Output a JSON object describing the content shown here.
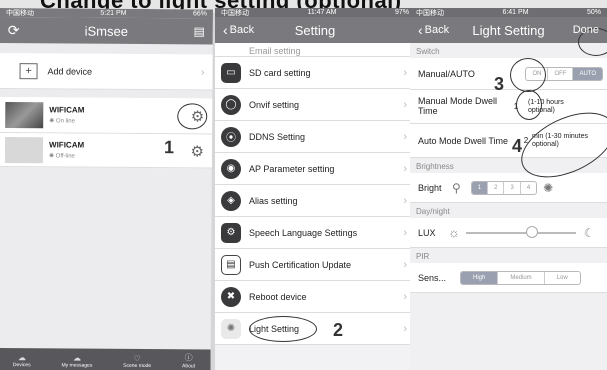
{
  "top_caption": "Change to light setting (optional)",
  "panel1": {
    "status": {
      "carrier": "中国移动",
      "time": "5:21 PM",
      "battery": "66%"
    },
    "title": "iSmsee",
    "add_device": "Add device",
    "cameras": [
      {
        "name": "WIFICAM",
        "status": "On line"
      },
      {
        "name": "WIFICAM",
        "status": "Off-line"
      }
    ],
    "step_number": "1",
    "tabs": [
      "Devices",
      "My messages",
      "Scene mode",
      "About"
    ]
  },
  "panel2": {
    "status": {
      "carrier": "中国移动",
      "time": "11:47 AM",
      "battery": "97%"
    },
    "back": "Back",
    "title": "Setting",
    "partial_item": "Email setting",
    "items": [
      {
        "label": "SD card setting",
        "icon": "sd-card-icon"
      },
      {
        "label": "Onvif setting",
        "icon": "onvif-icon"
      },
      {
        "label": "DDNS Setting",
        "icon": "ddns-icon"
      },
      {
        "label": "AP Parameter setting",
        "icon": "ap-icon"
      },
      {
        "label": "Alias setting",
        "icon": "alias-icon"
      },
      {
        "label": "Speech Language Settings",
        "icon": "speech-gear-icon"
      },
      {
        "label": "Push Certification Update",
        "icon": "push-cert-icon"
      },
      {
        "label": "Reboot device",
        "icon": "reboot-icon"
      },
      {
        "label": "Light Setting",
        "icon": "light-bulb-icon"
      }
    ],
    "step_number": "2"
  },
  "panel3": {
    "status": {
      "carrier": "中国移动",
      "time": "6:41 PM",
      "battery": "50%"
    },
    "back": "Back",
    "title": "Light Setting",
    "done": "Done",
    "sections": {
      "switch": "Switch",
      "brightness": "Brightness",
      "day_night": "Day/night",
      "pir": "PIR"
    },
    "manual_auto_label": "Manual/AUTO",
    "mode_options": [
      "ON",
      "OFF",
      "AUTO"
    ],
    "mode_selected": "AUTO",
    "manual_dwell_label": "Manual Mode Dwell Time",
    "manual_dwell_value": "1",
    "manual_dwell_hint": "(1-10 hours optional)",
    "auto_dwell_label": "Auto Mode Dwell Time",
    "auto_dwell_value": "2",
    "auto_dwell_hint": "min (1-30 minutes optional)",
    "bright_label": "Bright",
    "bright_levels": [
      "1",
      "2",
      "3",
      "4"
    ],
    "bright_selected": "1",
    "lux_label": "LUX",
    "lux_slider_fraction": 0.6,
    "pir_label": "Sens...",
    "pir_options": [
      "High",
      "Medium",
      "Low"
    ],
    "pir_selected": "High",
    "step3": "3",
    "step4": "4"
  },
  "colors": {
    "navbar": "#7a7a7e",
    "selected_segment": "#9aa0b0",
    "tabbar": "#58585c"
  }
}
